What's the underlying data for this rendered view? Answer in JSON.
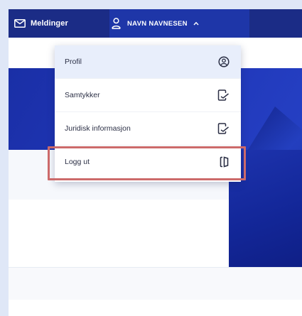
{
  "header": {
    "messages_label": "Meldinger",
    "user_name": "NAVN NAVNESEN"
  },
  "user_menu": {
    "items": [
      {
        "label": "Profil",
        "icon": "profile-circle-icon"
      },
      {
        "label": "Samtykker",
        "icon": "document-sign-icon"
      },
      {
        "label": "Juridisk informasjon",
        "icon": "document-sign-icon"
      },
      {
        "label": "Logg ut",
        "icon": "logout-icon"
      }
    ]
  },
  "colors": {
    "topbar": "#1b2c86",
    "hero": "#1f35b6",
    "highlight": "#cc6a6a",
    "selected_item": "#e8eefb"
  }
}
